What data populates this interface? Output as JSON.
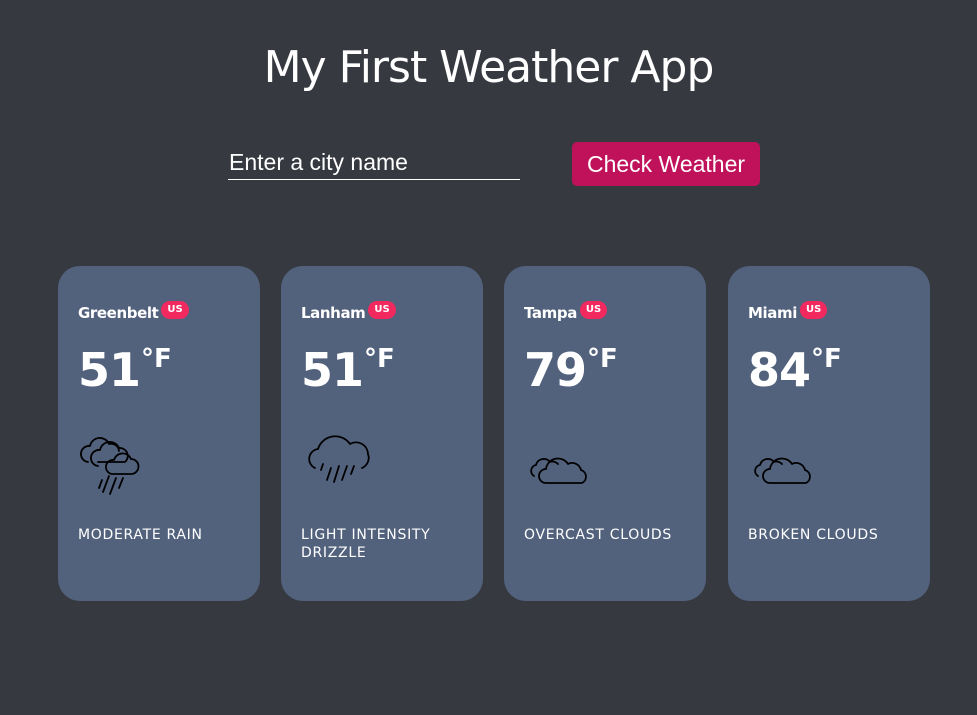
{
  "app": {
    "title": "My First Weather App"
  },
  "search": {
    "placeholder": "Enter a city name",
    "value": "",
    "button_label": "Check Weather"
  },
  "colors": {
    "background": "#363940",
    "card": "#52627d",
    "button": "#c0125b",
    "badge": "#f2295f"
  },
  "cards": [
    {
      "city": "Greenbelt",
      "country": "US",
      "temp": "51",
      "unit": "°F",
      "icon": "rain-icon",
      "description": "MODERATE RAIN"
    },
    {
      "city": "Lanham",
      "country": "US",
      "temp": "51",
      "unit": "°F",
      "icon": "drizzle-icon",
      "description": "LIGHT INTENSITY DRIZZLE"
    },
    {
      "city": "Tampa",
      "country": "US",
      "temp": "79",
      "unit": "°F",
      "icon": "clouds-icon",
      "description": "OVERCAST CLOUDS"
    },
    {
      "city": "Miami",
      "country": "US",
      "temp": "84",
      "unit": "°F",
      "icon": "clouds-icon",
      "description": "BROKEN CLOUDS"
    }
  ]
}
